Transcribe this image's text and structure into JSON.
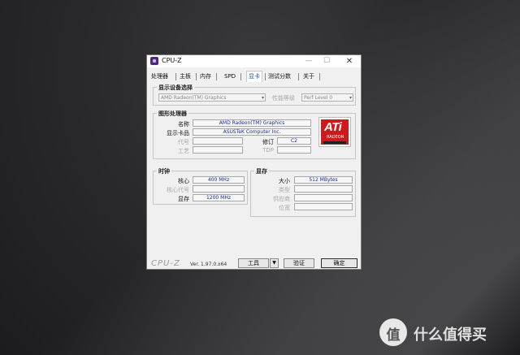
{
  "window": {
    "title": "CPU-Z",
    "minimize": "—",
    "maximize": "☐",
    "close": "✕"
  },
  "tabs": [
    "处理器",
    "主板",
    "内存",
    "SPD",
    "显卡",
    "测试分数",
    "关于"
  ],
  "active_tab": "显卡",
  "device_section": {
    "title": "显示设备选择",
    "device_value": "AMD Radeon(TM) Graphics",
    "perf_label": "性能等级",
    "perf_value": "Perf Level 0"
  },
  "gpu_section": {
    "title": "图形处理器",
    "name_label": "名称",
    "name_value": "AMD Radeon(TM) Graphics",
    "board_label": "显示卡品",
    "board_value": "ASUSTeK Computer Inc.",
    "code_label": "代号",
    "code_value": "",
    "revision_label": "修订",
    "revision_value": "C2",
    "tech_label": "工艺",
    "tech_value": "",
    "tdp_label": "TDP",
    "tdp_value": ""
  },
  "clocks_section": {
    "title": "时钟",
    "core_label": "核心",
    "core_value": "400 MHz",
    "shader_label": "核心代号",
    "shader_value": "",
    "memory_label": "显存",
    "memory_value": "1200 MHz"
  },
  "memory_section": {
    "title": "显存",
    "size_label": "大小",
    "size_value": "512 MBytes",
    "type_label": "类型",
    "type_value": "",
    "vendor_label": "供应商",
    "vendor_value": "",
    "width_label": "位宽",
    "width_value": ""
  },
  "logo": {
    "word": "ATi",
    "sub": "RADEON"
  },
  "footer": {
    "brand": "CPU-Z",
    "version": "Ver. 1.97.0.x64",
    "tools_label": "工具",
    "dropdown_arrow": "▼",
    "validate_label": "验证",
    "ok_label": "确定"
  },
  "watermark": {
    "badge": "值",
    "text": "什么值得买"
  }
}
